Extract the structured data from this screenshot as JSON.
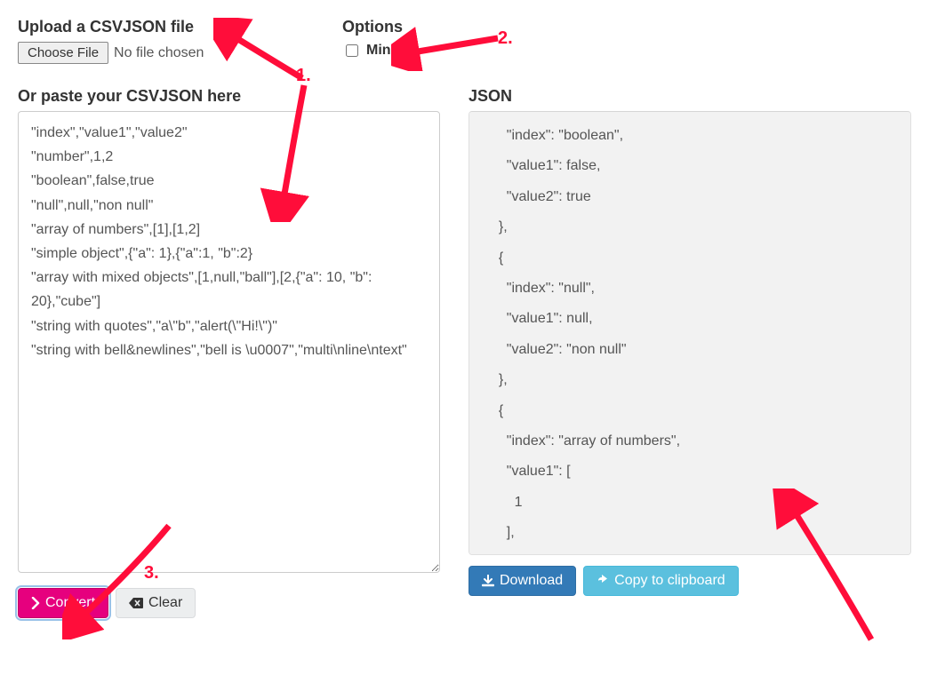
{
  "upload": {
    "heading": "Upload a CSVJSON file",
    "choose_btn": "Choose File",
    "no_file_text": "No file chosen"
  },
  "options": {
    "heading": "Options",
    "minify_label": "Minify",
    "minify_checked": false
  },
  "left": {
    "heading": "Or paste your CSVJSON here",
    "value": "\"index\",\"value1\",\"value2\"\n\"number\",1,2\n\"boolean\",false,true\n\"null\",null,\"non null\"\n\"array of numbers\",[1],[1,2]\n\"simple object\",{\"a\": 1},{\"a\":1, \"b\":2}\n\"array with mixed objects\",[1,null,\"ball\"],[2,{\"a\": 10, \"b\": 20},\"cube\"]\n\"string with quotes\",\"a\\\"b\",\"alert(\\\"Hi!\\\")\"\n\"string with bell&newlines\",\"bell is \\u0007\",\"multi\\nline\\ntext\""
  },
  "right": {
    "heading": "JSON",
    "value": "    \"index\": \"boolean\",\n    \"value1\": false,\n    \"value2\": true\n  },\n  {\n    \"index\": \"null\",\n    \"value1\": null,\n    \"value2\": \"non null\"\n  },\n  {\n    \"index\": \"array of numbers\",\n    \"value1\": [\n      1\n    ],"
  },
  "buttons": {
    "convert": "Convert",
    "clear": "Clear",
    "download": "Download",
    "copy": "Copy to clipboard"
  },
  "annotations": {
    "one": "1.",
    "two": "2.",
    "three": "3."
  },
  "colors": {
    "annotation_red": "#ff0d3a",
    "convert_pink": "#e6007e",
    "primary_blue": "#337ab7",
    "info_blue": "#5bc0de"
  }
}
